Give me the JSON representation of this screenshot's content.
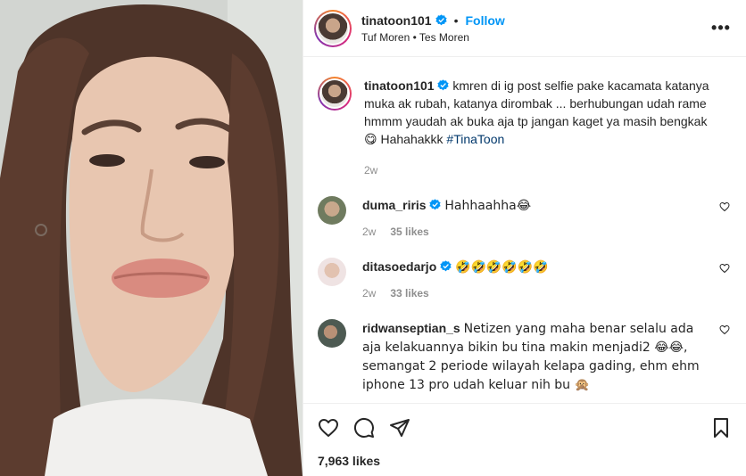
{
  "post": {
    "author": {
      "username": "tinatoon101",
      "follow_label": "Follow",
      "location_line": "Tuf Moren • Tes Moren",
      "avatar_icon": "profile-photo"
    },
    "more_label": "•••",
    "caption": {
      "username": "tinatoon101",
      "text": "kmren di ig post selfie pake kacamata katanya muka ak rubah, katanya dirombak ... berhubungan udah rame hmmm yaudah ak buka aja tp jangan kaget ya masih bengkak 😋 Hahahakkk ",
      "hashtag": "#TinaToon",
      "age": "2w"
    },
    "comments": [
      {
        "username": "duma_riris",
        "verified": true,
        "text": "Hahhaahha😂",
        "age": "2w",
        "likes": "35 likes",
        "avatar_color": "#7a8a6a"
      },
      {
        "username": "ditasoedarjo",
        "verified": true,
        "text": "🤣🤣🤣🤣🤣🤣",
        "age": "2w",
        "likes": "33 likes",
        "avatar_color": "#d9c3c3"
      },
      {
        "username": "ridwanseptian_s",
        "verified": false,
        "text": "Netizen yang maha benar selalu ada aja kelakuannya bikin bu tina makin menjadi2 😂😂, semangat 2 periode wilayah kelapa gading, ehm ehm iphone 13 pro udah keluar nih bu 🙊",
        "age": "",
        "likes": "",
        "avatar_color": "#4d5a52"
      }
    ],
    "like_count": "7,963 likes",
    "colors": {
      "accent": "#0095f6",
      "verified": "#0095f6",
      "text": "#262626",
      "muted": "#8e8e8e"
    }
  }
}
